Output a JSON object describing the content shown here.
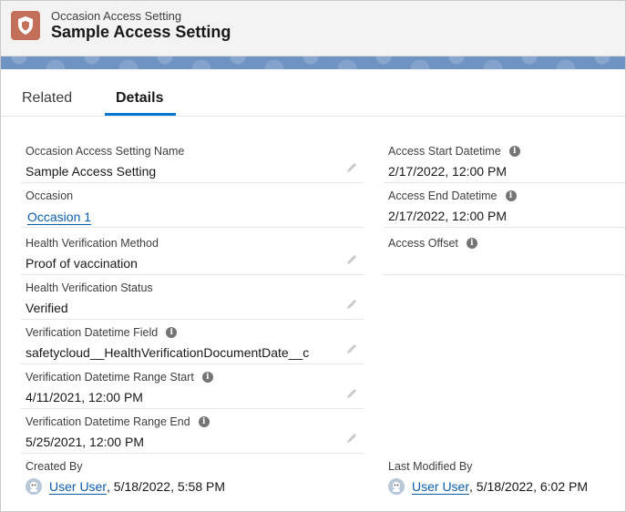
{
  "header": {
    "object_label": "Occasion Access Setting",
    "record_title": "Sample Access Setting"
  },
  "tabs": [
    {
      "label": "Related",
      "active": false
    },
    {
      "label": "Details",
      "active": true
    }
  ],
  "left_fields": [
    {
      "label": "Occasion Access Setting Name",
      "value": "Sample Access Setting",
      "link": false,
      "info": false,
      "editable": true
    },
    {
      "label": "Occasion",
      "value": "Occasion 1",
      "link": true,
      "info": false,
      "editable": false
    },
    {
      "label": "Health Verification Method",
      "value": "Proof of vaccination",
      "link": false,
      "info": false,
      "editable": true
    },
    {
      "label": "Health Verification Status",
      "value": "Verified",
      "link": false,
      "info": false,
      "editable": true
    },
    {
      "label": "Verification Datetime Field",
      "value": "safetycloud__HealthVerificationDocumentDate__c",
      "link": false,
      "info": true,
      "editable": true
    },
    {
      "label": "Verification Datetime Range Start",
      "value": "4/11/2021, 12:00 PM",
      "link": false,
      "info": true,
      "editable": true
    },
    {
      "label": "Verification Datetime Range End",
      "value": "5/25/2021, 12:00 PM",
      "link": false,
      "info": true,
      "editable": true
    }
  ],
  "right_fields": [
    {
      "label": "Access Start Datetime",
      "value": "2/17/2022, 12:00 PM",
      "info": true
    },
    {
      "label": "Access End Datetime",
      "value": "2/17/2022, 12:00 PM",
      "info": true
    },
    {
      "label": "Access Offset",
      "value": "",
      "info": true
    }
  ],
  "created_by": {
    "label": "Created By",
    "user": "User User",
    "date": ", 5/18/2022, 5:58 PM"
  },
  "last_modified_by": {
    "label": "Last Modified By",
    "user": "User User",
    "date": ", 5/18/2022, 6:02 PM"
  },
  "colors": {
    "accent": "#0176d3",
    "link": "#0b5cab",
    "record_icon": "#c2705a"
  }
}
